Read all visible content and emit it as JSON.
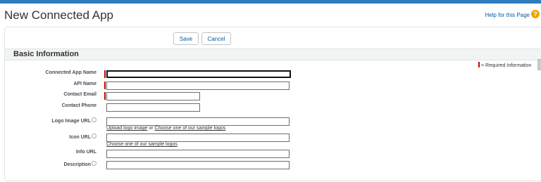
{
  "header": {
    "title": "New Connected App",
    "help_link": "Help for this Page",
    "help_icon": "?"
  },
  "buttons": {
    "save": "Save",
    "cancel": "Cancel"
  },
  "section": {
    "title": "Basic Information"
  },
  "required_legend": "= Required Information",
  "fields": {
    "connected_app_name": {
      "label": "Connected App Name",
      "value": ""
    },
    "api_name": {
      "label": "API Name",
      "value": ""
    },
    "contact_email": {
      "label": "Contact Email",
      "value": ""
    },
    "contact_phone": {
      "label": "Contact Phone",
      "value": ""
    },
    "logo_image_url": {
      "label": "Logo Image URL",
      "value": ""
    },
    "icon_url": {
      "label": "Icon URL",
      "value": ""
    },
    "info_url": {
      "label": "Info URL",
      "value": ""
    },
    "description": {
      "label": "Description",
      "value": ""
    }
  },
  "links": {
    "upload_logo": "Upload logo image",
    "or": "or",
    "choose_logo": "Choose one of our sample logos",
    "choose_icon": "Choose one of our sample logos"
  },
  "colors": {
    "required": "#cc0000",
    "link": "#015ba7",
    "accent": "#2f7bbf",
    "help_icon": "#f0a400"
  }
}
